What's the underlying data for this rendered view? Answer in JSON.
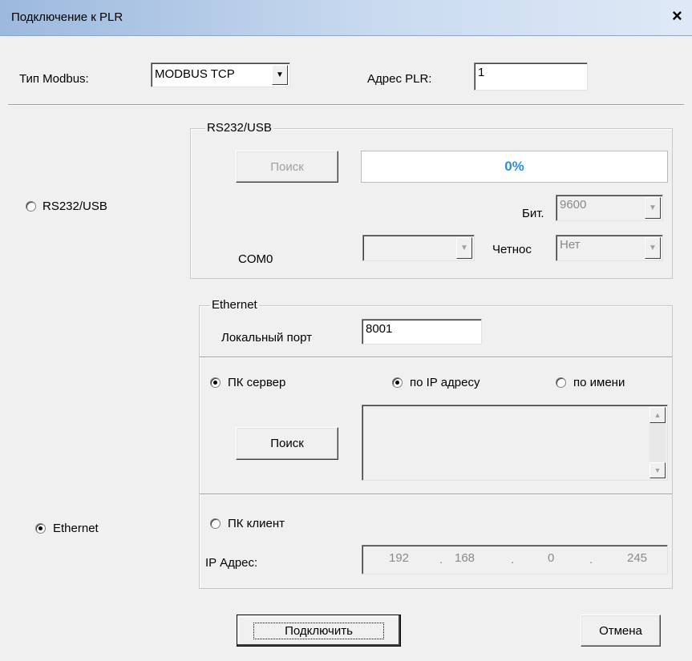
{
  "window": {
    "title": "Подключение к PLR",
    "close_glyph": "×"
  },
  "modbus": {
    "type_label": "Тип Modbus:",
    "type_value": "MODBUS TCP",
    "address_label": "Адрес PLR:",
    "address_value": "1"
  },
  "rs232": {
    "radio_label": "RS232/USB",
    "group_title": "RS232/USB",
    "search_button": "Поиск",
    "progress_text": "0%",
    "progress_value": 0,
    "bits_label": "Бит.",
    "bits_value": "9600",
    "port_label": "COM0",
    "port_value": "",
    "parity_label": "Четнос",
    "parity_value": "Нет"
  },
  "ethernet": {
    "radio_label": "Ethernet",
    "group_title": "Ethernet",
    "local_port_label": "Локальный порт",
    "local_port_value": "8001",
    "pc_server_label": "ПК сервер",
    "by_ip_label": "по IP адресу",
    "by_name_label": "по имени",
    "search_button": "Поиск",
    "list_items": [],
    "pc_client_label": "ПК клиент",
    "ip_label": "IP Адрес:",
    "ip_octets": [
      "192",
      "168",
      "0",
      "245"
    ],
    "ip_dot": "."
  },
  "selection": {
    "connection": "Ethernet",
    "mode": "pc_server",
    "server_lookup": "by_ip"
  },
  "footer": {
    "connect_button": "Подключить",
    "cancel_button": "Отмена"
  },
  "colors": {
    "titlebar_start": "#9cb9dd",
    "progress_text": "#2d8ed8",
    "background": "#f0f0f0"
  },
  "icons": {
    "dropdown": "chevron-down-icon",
    "scroll_up": "scroll-up-icon",
    "scroll_down": "scroll-down-icon",
    "close": "close-icon"
  }
}
